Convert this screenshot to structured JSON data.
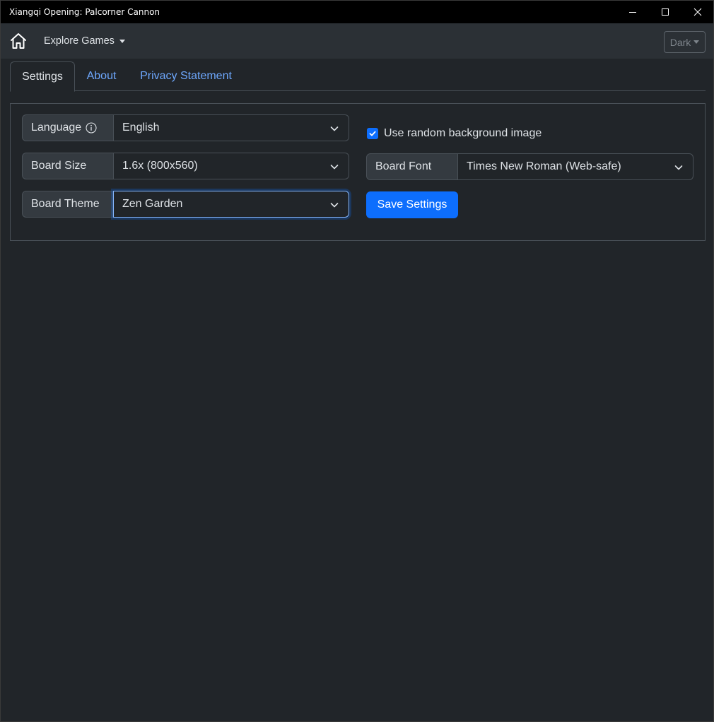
{
  "window": {
    "title": "Xiangqi Opening: Palcorner Cannon",
    "controls": [
      "minimize-icon",
      "maximize-icon",
      "close-icon"
    ]
  },
  "navbar": {
    "home_icon": "home-icon",
    "explore_label": "Explore Games",
    "theme_label": "Dark"
  },
  "tabs": [
    {
      "label": "Settings",
      "active": true
    },
    {
      "label": "About",
      "active": false
    },
    {
      "label": "Privacy Statement",
      "active": false
    }
  ],
  "settings": {
    "language": {
      "label": "Language",
      "value": "English",
      "icon": "info-icon"
    },
    "board_size": {
      "label": "Board Size",
      "value": "1.6x (800x560)"
    },
    "board_theme": {
      "label": "Board Theme",
      "value": "Zen Garden"
    },
    "random_bg": {
      "label": "Use random background image",
      "checked": true
    },
    "board_font": {
      "label": "Board Font",
      "value": "Times New Roman (Web-safe)"
    },
    "save_label": "Save Settings"
  },
  "colors": {
    "background": "#212529",
    "accent": "#0d6efd",
    "link": "#6ea8fe",
    "titlebar": "#000000",
    "navbar": "#2b3035"
  }
}
